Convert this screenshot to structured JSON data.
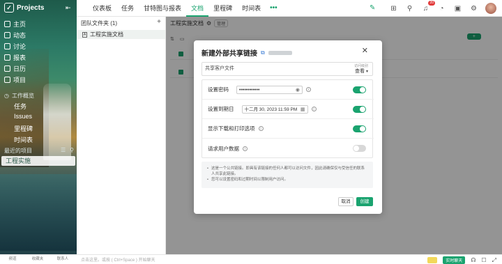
{
  "app": {
    "name": "Projects"
  },
  "sidebar": {
    "nav": [
      {
        "label": "主页",
        "icon": "home-icon"
      },
      {
        "label": "动态",
        "icon": "activity-icon"
      },
      {
        "label": "讨论",
        "icon": "discussion-icon"
      },
      {
        "label": "报表",
        "icon": "report-icon"
      },
      {
        "label": "日历",
        "icon": "calendar-icon"
      },
      {
        "label": "项目",
        "icon": "project-icon"
      }
    ],
    "project_overview": "工作概览",
    "sub_items": [
      "任务",
      "Issues",
      "里程碑",
      "时间表"
    ],
    "recent_label": "最近的项目",
    "recent_item": "工程实施"
  },
  "topbar": {
    "tabs": [
      "仪表板",
      "任务",
      "甘特图与报表",
      "文档",
      "里程碑",
      "时间表"
    ],
    "active_tab": "文档",
    "more": "•••",
    "notification_count": "20"
  },
  "folders": {
    "header": "团队文件夹 (1)",
    "item": "工程实施文档"
  },
  "main": {
    "breadcrumb": "工程实施文档",
    "badge": "管理"
  },
  "modal": {
    "title": "新建外部共享链接",
    "share_name": "共享客户文件",
    "perm_label": "访问级别",
    "perm_value": "查看",
    "rows": [
      {
        "label": "设置密码",
        "value": "••••••••••••",
        "toggle": true
      },
      {
        "label": "设置到期日",
        "value": "十二月 30, 2023 11:59 PM",
        "toggle": true
      },
      {
        "label": "显示下载和打印选项",
        "toggle": true
      },
      {
        "label": "请求用户数据",
        "toggle": false
      }
    ],
    "notes": [
      "这是一个公共链接。即具有该链接的任何人都可以访问文件，因此请确保仅与受信任的联系人共享此链接。",
      "您可以设置密码和过期时间以限制用户访问。"
    ],
    "cancel": "取消",
    "create": "创建"
  },
  "bottombar": {
    "items": [
      "频道",
      "收藏夹",
      "联系人"
    ],
    "input_placeholder": "点击这里。或按 ( Ctrl+Space ) 开始聊天",
    "chat_button": "实时聊天"
  },
  "colors": {
    "accent": "#1aa36f"
  }
}
